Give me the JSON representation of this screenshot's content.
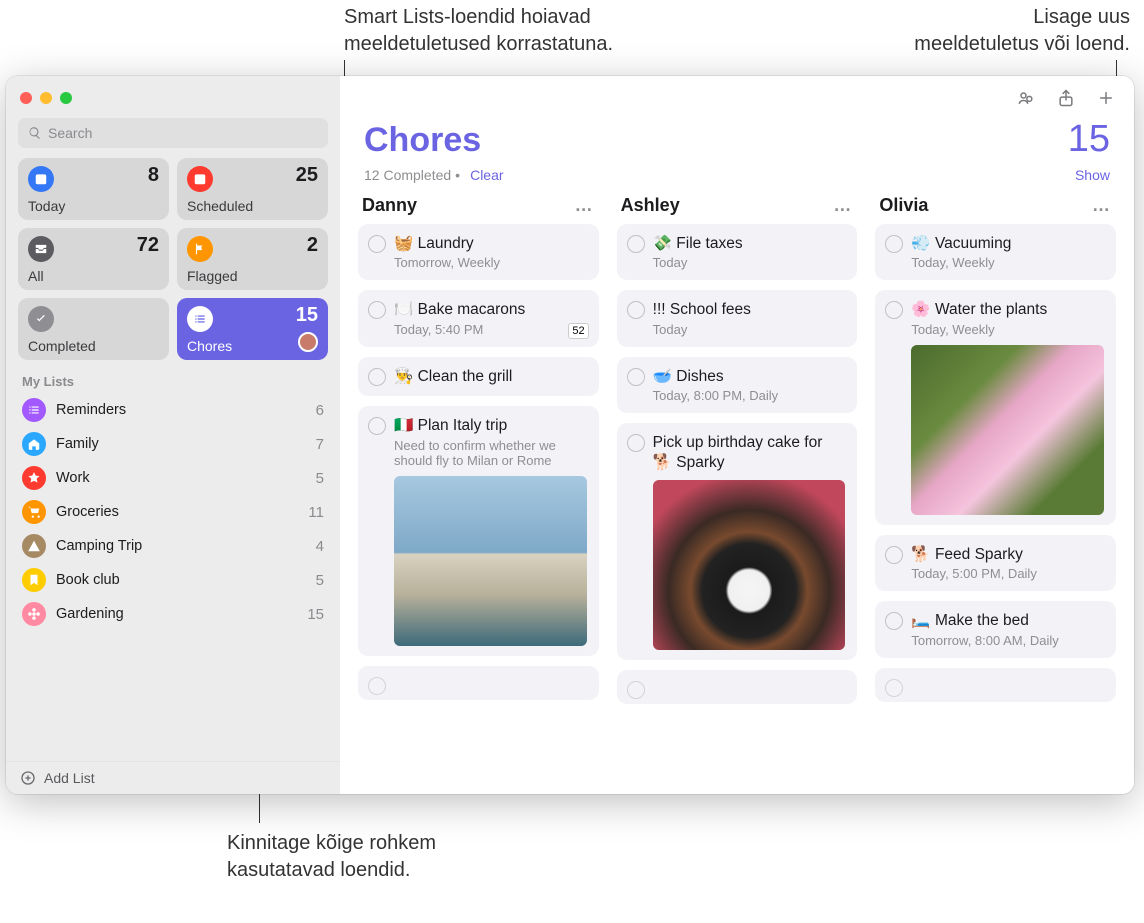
{
  "callouts": {
    "smartlists": "Smart Lists-loendid hoiavad\nmeeldetuletused korrastatuna.",
    "add": "Lisage uus\nmeeldetuletus või loend.",
    "pin": "Kinnitage kõige rohkem\nkasutatavad loendid."
  },
  "search": {
    "placeholder": "Search"
  },
  "smart": [
    {
      "id": "today",
      "label": "Today",
      "count": 8
    },
    {
      "id": "scheduled",
      "label": "Scheduled",
      "count": 25
    },
    {
      "id": "all",
      "label": "All",
      "count": 72
    },
    {
      "id": "flagged",
      "label": "Flagged",
      "count": 2
    },
    {
      "id": "completed",
      "label": "Completed",
      "count": ""
    },
    {
      "id": "chores",
      "label": "Chores",
      "count": 15,
      "active": true,
      "avatar": true
    }
  ],
  "mylists_header": "My Lists",
  "lists": [
    {
      "name": "Reminders",
      "count": 6,
      "color": "#a259ff",
      "icon": "list"
    },
    {
      "name": "Family",
      "count": 7,
      "color": "#2aa7ff",
      "icon": "home"
    },
    {
      "name": "Work",
      "count": 5,
      "color": "#ff3b30",
      "icon": "star"
    },
    {
      "name": "Groceries",
      "count": 11,
      "color": "#ff9500",
      "icon": "cart"
    },
    {
      "name": "Camping Trip",
      "count": 4,
      "color": "#a68a64",
      "icon": "tent"
    },
    {
      "name": "Book club",
      "count": 5,
      "color": "#ffcc00",
      "icon": "bookmark"
    },
    {
      "name": "Gardening",
      "count": 15,
      "color": "#ff8aa1",
      "icon": "flower"
    }
  ],
  "addlist_label": "Add List",
  "main": {
    "title": "Chores",
    "count": 15,
    "completed_text": "12 Completed",
    "clear_label": "Clear",
    "show_label": "Show"
  },
  "columns": [
    {
      "name": "Danny",
      "items": [
        {
          "title": "🧺 Laundry",
          "meta": "Tomorrow, Weekly"
        },
        {
          "title": "🍽️ Bake macarons",
          "meta": "Today, 5:40 PM",
          "badge": "52"
        },
        {
          "title": "👨‍🍳 Clean the grill"
        },
        {
          "title": "🇮🇹 Plan Italy trip",
          "note": "Need to confirm whether we should fly to Milan or Rome",
          "image": "linear-gradient(180deg,#a7c8e0 0%,#7fa9c8 45%,#d8d2c0 46%,#b7b09a 70%,#3d6a7a 100%)"
        }
      ],
      "empty": true
    },
    {
      "name": "Ashley",
      "items": [
        {
          "title": "💸 File taxes",
          "meta": "Today"
        },
        {
          "title": "!!! School fees",
          "meta": "Today"
        },
        {
          "title": "🥣 Dishes",
          "meta": "Today, 8:00 PM, Daily"
        },
        {
          "title": "Pick up birthday cake for 🐕 Sparky",
          "image": "radial-gradient(circle at 50% 65%, #f5f5f5 0%, #f0f0f0 14%, #1b1b1b 16%, #222 32%, #784a2e 40%, #3a2a24 55%, #c0475c 80%)"
        }
      ],
      "empty": true
    },
    {
      "name": "Olivia",
      "items": [
        {
          "title": "💨 Vacuuming",
          "meta": "Today, Weekly"
        },
        {
          "title": "🌸 Water the plants",
          "meta": "Today, Weekly",
          "image": "linear-gradient(135deg,#4b6b2e 0%,#6a8b3f 30%,#e7a6c7 45%,#f4c4dd 60%,#5a7b35 80%)"
        },
        {
          "title": "🐕 Feed Sparky",
          "meta": "Today, 5:00 PM, Daily"
        },
        {
          "title": "🛏️ Make the bed",
          "meta": "Tomorrow, 8:00 AM, Daily"
        }
      ],
      "empty": true
    }
  ]
}
